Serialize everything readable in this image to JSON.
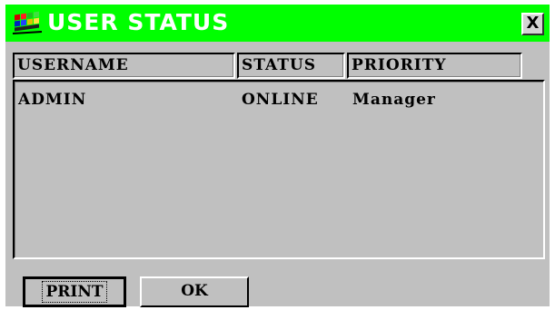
{
  "window": {
    "title": "USER STATUS",
    "close_label": "X",
    "icon": "windows-flag-icon"
  },
  "columns": [
    "USERNAME",
    "STATUS",
    "PRIORITY"
  ],
  "rows": [
    {
      "username": "ADMIN",
      "status": "ONLINE",
      "priority": "Manager"
    }
  ],
  "buttons": {
    "print_label": "PRINT",
    "ok_label": "OK"
  },
  "colors": {
    "titlebar": "#00ff00",
    "title_text": "#ffffff",
    "window_bg": "#c0c0c0"
  }
}
